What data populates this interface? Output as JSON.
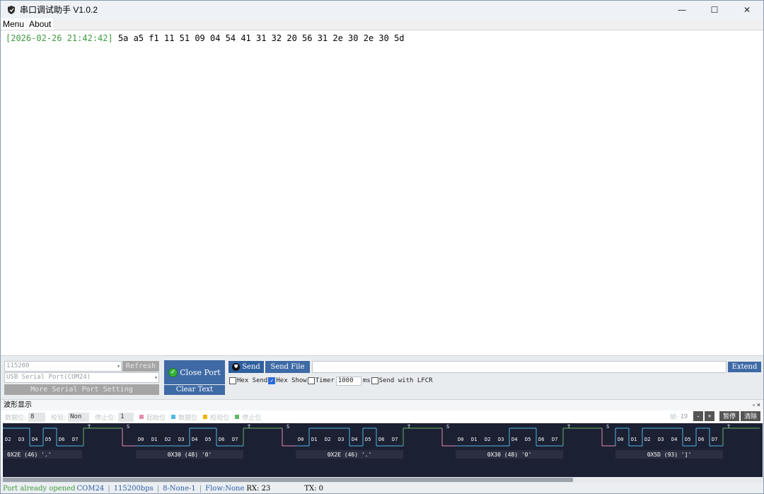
{
  "window": {
    "title": "串口调试助手 V1.0.2",
    "minimize": "—",
    "maximize": "☐",
    "close": "✕"
  },
  "menu": [
    "Menu",
    "About"
  ],
  "receive": {
    "timestamp": "[2026-02-26 21:42:42]",
    "data": " 5a a5 f1 11 51 09 04 54 41 31 32 20 56 31 2e 30 2e 30 5d"
  },
  "port": {
    "baud": "115200",
    "device": "USB Serial Port(COM24)",
    "refresh": "Refresh",
    "more_settings": "More Serial Port Setting",
    "close_port": "Close Port",
    "clear_text": "Clear Text"
  },
  "send": {
    "send": "Send",
    "send_file": "Send File",
    "extend": "Extend",
    "input_value": "",
    "hex_send": "Hex Send",
    "hex_show": "Hex Show",
    "timer": "Timer",
    "timer_value": "1000",
    "ms": "ms",
    "lfcr": "Send with LFCR"
  },
  "wave": {
    "header": "波形显示",
    "header_buttons": "▫ ×",
    "data_bits_label": "数据位:",
    "data_bits": "8",
    "parity_label": "校验:",
    "parity": "Non",
    "stop_bits_label": "停止位:",
    "stop_bits": "1",
    "legend": [
      {
        "label": "起始位",
        "color": "#e58bb0"
      },
      {
        "label": "数据位",
        "color": "#4fb6e6"
      },
      {
        "label": "校验位",
        "color": "#f0b400"
      },
      {
        "label": "停止位",
        "color": "#5fb85f"
      }
    ],
    "frame_label": "帧:",
    "frame_count": "19",
    "minus": "-",
    "plus": "+",
    "pause": "暂停",
    "clear": "清除",
    "bytes": [
      {
        "label": "0X2E (46) '.'"
      },
      {
        "label": "0X30 (48) '0'"
      },
      {
        "label": "0X2E (46) '.'"
      },
      {
        "label": "0X30 (48) '0'"
      },
      {
        "label": "0X5D (93) ']'"
      }
    ],
    "first_partial_bits": [
      "D2",
      "D3",
      "D4",
      "D5",
      "D6",
      "D7"
    ],
    "bit_names": [
      "D0",
      "D1",
      "D2",
      "D3",
      "D4",
      "D5",
      "D6",
      "D7"
    ],
    "marker_start": "S",
    "marker_stop": "T"
  },
  "status": {
    "msg": "Port already opened",
    "port": "COM24",
    "baud": "115200bps",
    "format": "8-None-1",
    "flow": "Flow:None",
    "rx": "RX: 23",
    "tx": "TX: 0",
    "sep": "|"
  }
}
